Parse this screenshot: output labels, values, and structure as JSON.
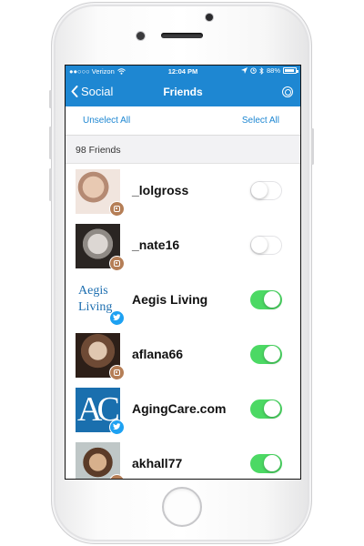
{
  "status_bar": {
    "carrier": "●●○○○ Verizon",
    "time": "12:04 PM",
    "battery": "88%"
  },
  "nav": {
    "back_label": "Social",
    "title": "Friends"
  },
  "select_bar": {
    "unselect_all": "Unselect All",
    "select_all": "Select All"
  },
  "section": {
    "header": "98 Friends"
  },
  "friends": [
    {
      "name": "_lolgross",
      "source": "instagram",
      "enabled": false
    },
    {
      "name": "_nate16",
      "source": "instagram",
      "enabled": false
    },
    {
      "name": "Aegis Living",
      "source": "twitter",
      "enabled": true
    },
    {
      "name": "aflana66",
      "source": "instagram",
      "enabled": true
    },
    {
      "name": "AgingCare.com",
      "source": "twitter",
      "enabled": true
    },
    {
      "name": "akhall77",
      "source": "instagram",
      "enabled": true
    }
  ],
  "logos": {
    "aegis_line1": "Aegis",
    "aegis_line2": "Living",
    "agingcare_letters": "AC"
  },
  "colors": {
    "bar_blue": "#1e87d2",
    "toggle_on": "#4cd964",
    "instagram_badge": "#b57e56",
    "twitter_badge": "#1da1f2"
  }
}
